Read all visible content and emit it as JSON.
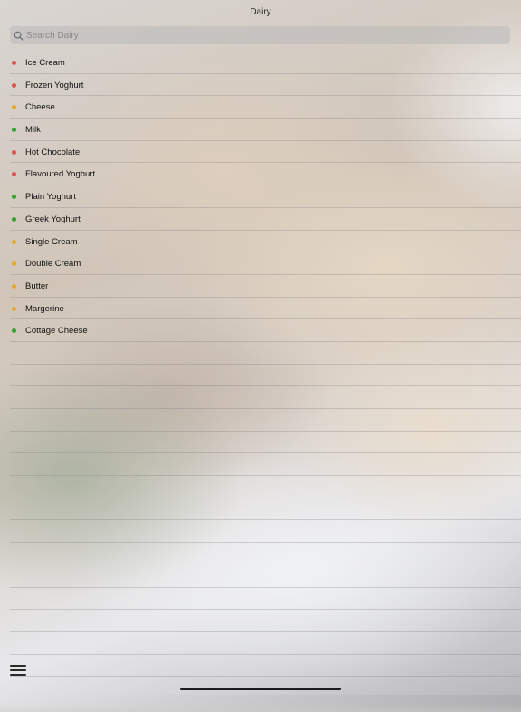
{
  "header": {
    "title": "Dairy"
  },
  "search": {
    "placeholder": "Search Dairy",
    "value": ""
  },
  "status_colors": {
    "red": "#d9534f",
    "amber": "#e5a823",
    "green": "#2ea52e"
  },
  "items": [
    {
      "label": "Ice Cream",
      "status": "red"
    },
    {
      "label": "Frozen Yoghurt",
      "status": "red"
    },
    {
      "label": "Cheese",
      "status": "amber"
    },
    {
      "label": "Milk",
      "status": "green"
    },
    {
      "label": "Hot Chocolate",
      "status": "red"
    },
    {
      "label": "Flavoured Yoghurt",
      "status": "red"
    },
    {
      "label": "Plain Yoghurt",
      "status": "green"
    },
    {
      "label": "Greek Yoghurt",
      "status": "green"
    },
    {
      "label": "Single Cream",
      "status": "amber"
    },
    {
      "label": "Double Cream",
      "status": "amber"
    },
    {
      "label": "Butter",
      "status": "amber"
    },
    {
      "label": "Margerine",
      "status": "amber"
    },
    {
      "label": "Cottage Cheese",
      "status": "green"
    }
  ],
  "empty_rows": 15,
  "toolbar": {
    "menu_icon": "hamburger-menu-icon"
  }
}
